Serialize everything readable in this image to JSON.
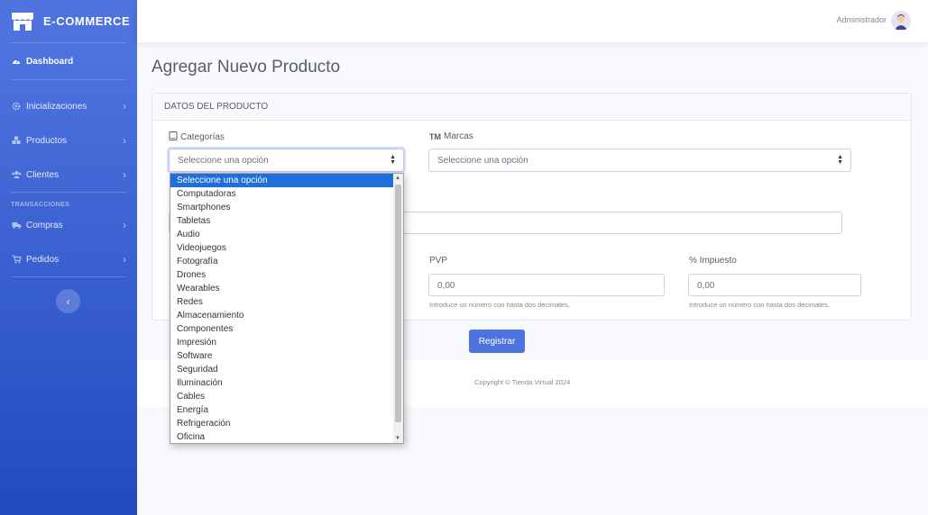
{
  "brand": {
    "name": "E-COMMERCE",
    "icon": "store-icon"
  },
  "sidebar": {
    "dashboard": {
      "label": "Dashboard",
      "icon": "dashboard-gauge-icon"
    },
    "items": [
      {
        "label": "Inicializaciones",
        "icon": "gear-icon"
      },
      {
        "label": "Productos",
        "icon": "boxes-icon"
      },
      {
        "label": "Clientes",
        "icon": "users-icon"
      }
    ],
    "section_heading": "TRANSACCIONES",
    "transactions": [
      {
        "label": "Compras",
        "icon": "truck-icon"
      },
      {
        "label": "Pedidos",
        "icon": "cart-icon"
      }
    ],
    "toggle_icon": "chevron-left-icon"
  },
  "topbar": {
    "user_name": "Administrador",
    "avatar_icon": "user-avatar-icon"
  },
  "page": {
    "title": "Agregar Nuevo Producto"
  },
  "card": {
    "header": "DATOS DEL PRODUCTO"
  },
  "form": {
    "categorias": {
      "label": "Categorías",
      "icon": "tablet-icon",
      "value": "Seleccione una opción"
    },
    "marcas": {
      "label": "Marcas",
      "icon_text": "TM",
      "value": "Seleccione una opción"
    },
    "pvp": {
      "label": "PVP",
      "value": "0,00",
      "help": "Introduce un número con hasta dos decimales."
    },
    "impuesto": {
      "label": "% Impuesto",
      "value": "0,00",
      "help": "Introduce un número con hasta dos decimales."
    },
    "submit_label": "Registrar"
  },
  "dropdown": {
    "options": [
      "Seleccione una opción",
      "Computadoras",
      "Smartphones",
      "Tabletas",
      "Audio",
      "Videojuegos",
      "Fotografía",
      "Drones",
      "Wearables",
      "Redes",
      "Almacenamiento",
      "Componentes",
      "Impresión",
      "Software",
      "Seguridad",
      "Iluminación",
      "Cables",
      "Energía",
      "Refrigeración",
      "Oficina"
    ],
    "selected_index": 0
  },
  "footer": {
    "copyright": "Copyright © Tienda Virtual 2024"
  },
  "colors": {
    "primary": "#4e73df",
    "sidebar_end": "#224abe",
    "selected_option": "#1e6fd9"
  }
}
